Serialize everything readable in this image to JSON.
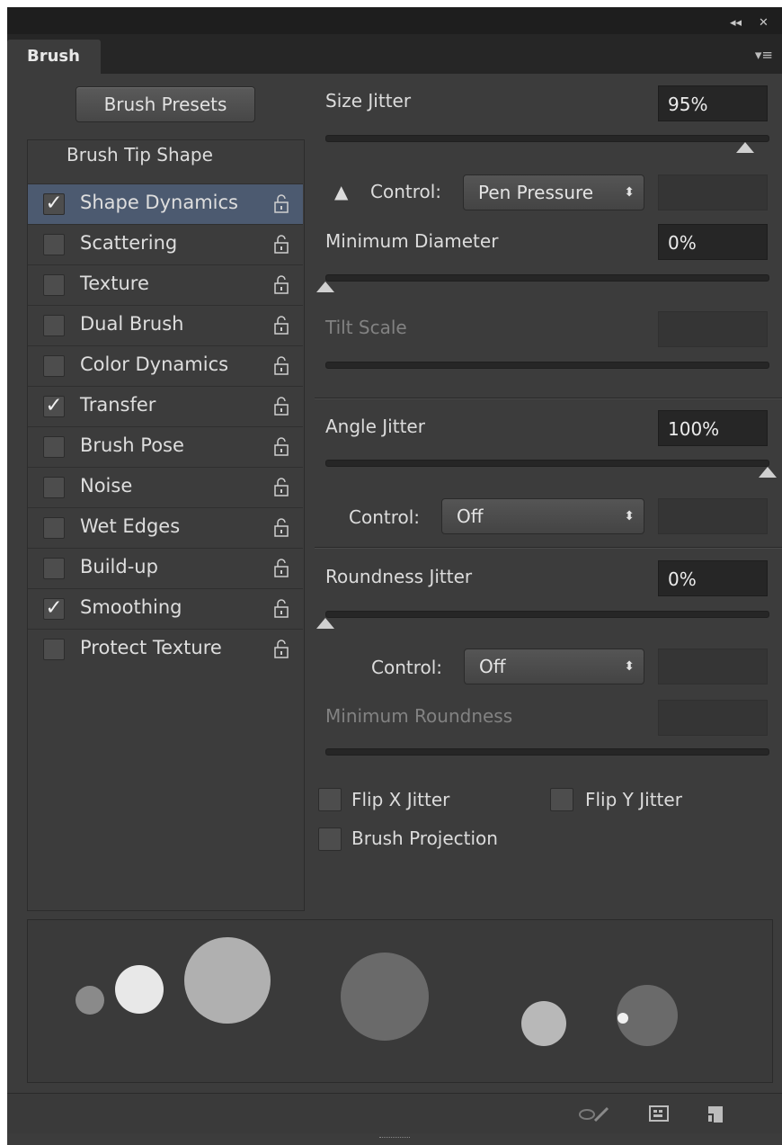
{
  "window": {
    "collapse_glyph": "◂◂",
    "close_glyph": "✕"
  },
  "tab": {
    "title": "Brush",
    "menu_glyph": "▾≡"
  },
  "presets_button": "Brush Presets",
  "sidebar": {
    "tip_shape": "Brush Tip Shape",
    "items": [
      {
        "label": "Shape Dynamics",
        "checked": true,
        "selected": true
      },
      {
        "label": "Scattering",
        "checked": false
      },
      {
        "label": "Texture",
        "checked": false
      },
      {
        "label": "Dual Brush",
        "checked": false
      },
      {
        "label": "Color Dynamics",
        "checked": false
      },
      {
        "label": "Transfer",
        "checked": true
      },
      {
        "label": "Brush Pose",
        "checked": false
      },
      {
        "label": "Noise",
        "checked": false
      },
      {
        "label": "Wet Edges",
        "checked": false
      },
      {
        "label": "Build-up",
        "checked": false
      },
      {
        "label": "Smoothing",
        "checked": true
      },
      {
        "label": "Protect Texture",
        "checked": false
      }
    ]
  },
  "settings": {
    "size_jitter": {
      "label": "Size Jitter",
      "value": "95%",
      "level": 0.95
    },
    "control1": {
      "warning": "▲",
      "label": "Control:",
      "value": "Pen Pressure"
    },
    "minimum_diameter": {
      "label": "Minimum Diameter",
      "value": "0%",
      "level": 0
    },
    "tilt_scale": {
      "label": "Tilt Scale"
    },
    "angle_jitter": {
      "label": "Angle Jitter",
      "value": "100%",
      "level": 1.0
    },
    "control2": {
      "label": "Control:",
      "value": "Off"
    },
    "roundness_jitter": {
      "label": "Roundness Jitter",
      "value": "0%",
      "level": 0
    },
    "control3": {
      "label": "Control:",
      "value": "Off"
    },
    "minimum_roundness": {
      "label": "Minimum Roundness"
    },
    "flip_x": "Flip X Jitter",
    "flip_y": "Flip Y Jitter",
    "brush_projection": "Brush Projection",
    "select_arrows": "⬍"
  },
  "colors": {
    "panel": "#3c3c3c",
    "selection": "#4c5a70",
    "field": "#262626"
  }
}
